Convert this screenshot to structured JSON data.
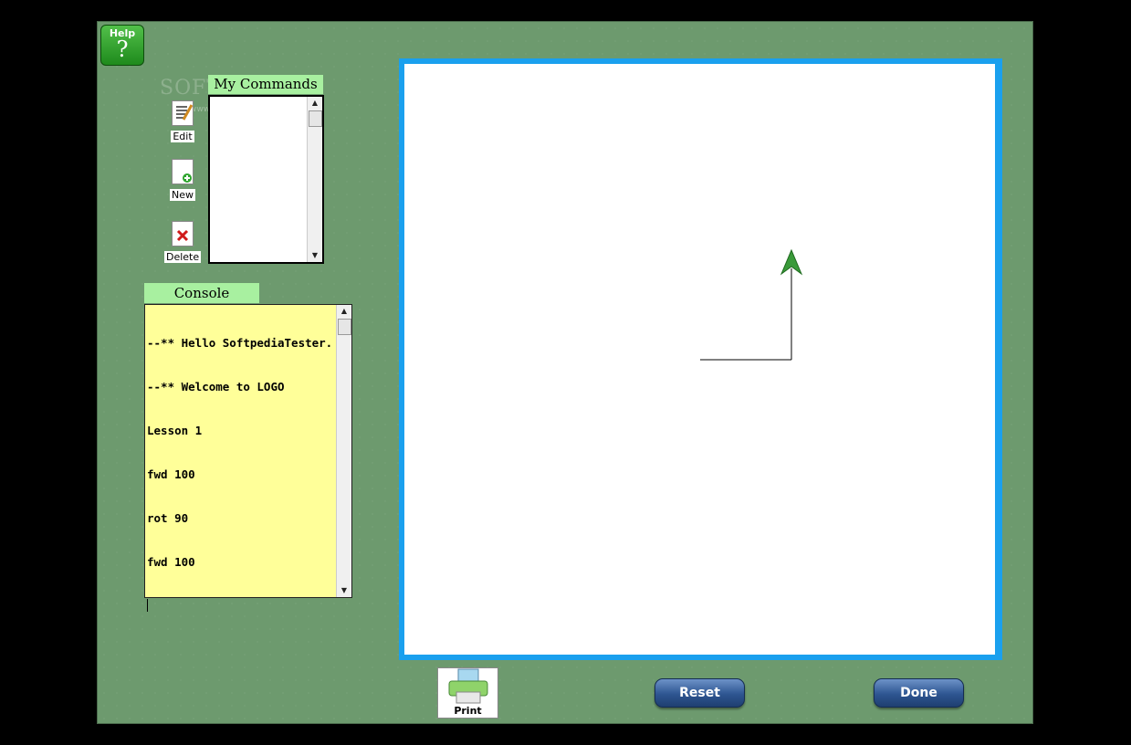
{
  "help": {
    "label": "Help",
    "symbol": "?"
  },
  "watermark": {
    "text": "SOFTPEDIA",
    "url": "www.softpedia.com"
  },
  "my_commands": {
    "title": "My Commands",
    "items": []
  },
  "side_actions": {
    "edit": "Edit",
    "new": "New",
    "delete": "Delete"
  },
  "console": {
    "title": "Console",
    "lines": [
      "--** Hello SoftpediaTester...",
      "--** Welcome to LOGO",
      "Lesson 1",
      "fwd 100",
      "rot 90",
      "fwd 100"
    ]
  },
  "buttons": {
    "print": "Print",
    "reset": "Reset",
    "done": "Done"
  },
  "colors": {
    "background": "#6d9a6e",
    "canvas_border": "#1aa0ee",
    "console_bg": "#ffff99",
    "header_bg": "#a8f0a0",
    "turtle": "#3a9a3a"
  }
}
